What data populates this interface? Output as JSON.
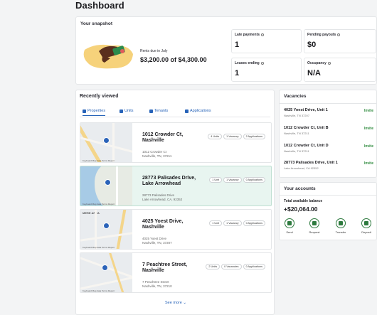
{
  "page": {
    "title": "Dashboard"
  },
  "snapshot": {
    "title": "Your snapshot",
    "rents_label": "Rents due in July",
    "rents_value": "$3,200.00 of $4,300.00",
    "stats": [
      {
        "label": "Late payments",
        "value": "1"
      },
      {
        "label": "Pending payouts",
        "value": "$0"
      },
      {
        "label": "Leases ending",
        "value": "1"
      },
      {
        "label": "Occupancy",
        "value": "N/A"
      }
    ]
  },
  "recent": {
    "title": "Recently viewed",
    "tabs": [
      "Properties",
      "Units",
      "Tenants",
      "Applications"
    ],
    "properties": [
      {
        "name": "1012 Crowder Ct, Nashville",
        "addr1": "1012 Crowder Ct",
        "addr2": "Nashville, TN, 37211",
        "badges": [
          "4 Units",
          "1 Vacancy",
          "2 Applications"
        ]
      },
      {
        "name": "28773 Palisades Drive, Lake Arrowhead",
        "addr1": "28773 Palisades Drive",
        "addr2": "Lake Arrowhead, CA, 92352",
        "badges": [
          "1 Unit",
          "1 Vacancy",
          "0 Applications"
        ]
      },
      {
        "name": "4025 Yoest Drive, Nashville",
        "addr1": "4025 Yoest Drive",
        "addr2": "Nashville, TN, 37207",
        "badges": [
          "1 Unit",
          "1 Vacancy",
          "0 Applications"
        ]
      },
      {
        "name": "7 Peachtree Street, Nashville",
        "addr1": "7 Peachtree Street",
        "addr2": "Nashville, TN, 37210",
        "badges": [
          "2 Units",
          "0 Vacancies",
          "0 Applications"
        ]
      }
    ],
    "map_footer": "Keyboard  Map data  Terms  Report",
    "map_area_label": "MERE AREA",
    "see_more": "See more ⌄"
  },
  "vacancies": {
    "title": "Vacancies",
    "link_label": "Invite",
    "items": [
      {
        "addr": "4025 Yoest Drive, Unit 1",
        "city": "Nashville, TN 37207"
      },
      {
        "addr": "1012 Crowder Ct, Unit B",
        "city": "Nashville, TN 37211"
      },
      {
        "addr": "1012 Crowder Ct, Unit D",
        "city": "Nashville, TN 37211"
      },
      {
        "addr": "28773 Palisades Drive, Unit 1",
        "city": "Lake Arrowhead, CA 92352"
      }
    ]
  },
  "accounts": {
    "title": "Your accounts",
    "balance_label": "Total available balance",
    "balance_value": "+$20,064.00",
    "actions": [
      "Send",
      "Request",
      "Transfer",
      "Deposit"
    ]
  },
  "colors": {
    "accent": "#2763b8",
    "green": "#2d8a3c",
    "selected_bg": "#e8f5f0"
  },
  "icons": {
    "tabs": [
      "building-icon",
      "unit-icon",
      "tenant-icon",
      "application-icon"
    ],
    "actions": [
      "send-icon",
      "request-icon",
      "transfer-icon",
      "deposit-icon"
    ]
  }
}
